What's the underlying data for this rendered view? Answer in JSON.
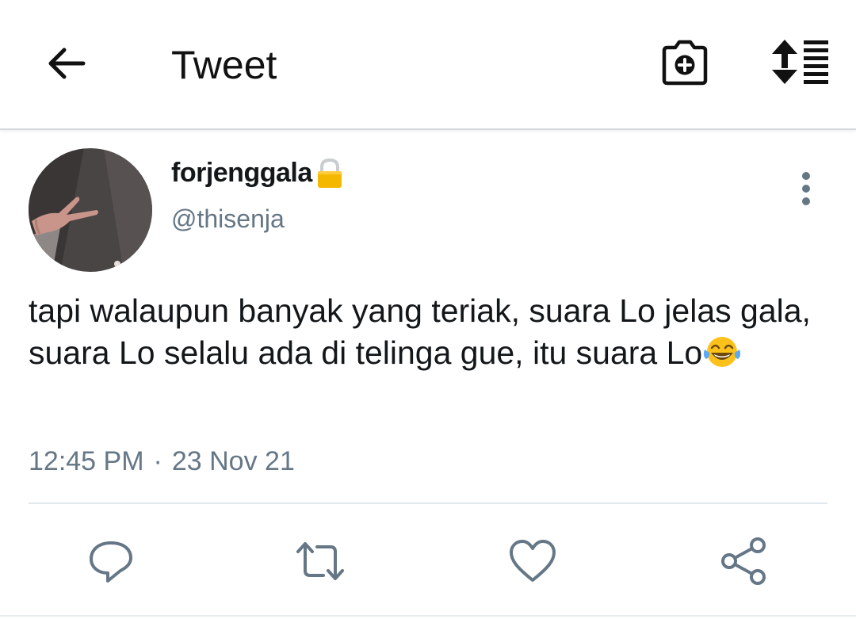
{
  "header": {
    "title": "Tweet",
    "back_icon": "arrow-left-icon",
    "camera_icon": "camera-plus-icon",
    "sort_icon": "sort-list-icon"
  },
  "author": {
    "display_name": "forjenggala",
    "handle": "@thisenja",
    "protected_icon": "lock-icon",
    "avatar_icon": "profile-photo",
    "more_icon": "vertical-dots-icon"
  },
  "tweet": {
    "text": "tapi walaupun banyak yang teriak, suara Lo jelas gala, suara Lo selalu ada di telinga gue, itu suara Lo",
    "emoji": "face-with-tears-of-joy-icon",
    "time": "12:45 PM",
    "separator": "·",
    "date": "23 Nov 21"
  },
  "actions": {
    "reply_icon": "reply-bubble-icon",
    "retweet_icon": "retweet-icon",
    "like_icon": "heart-icon",
    "share_icon": "share-icon"
  },
  "colors": {
    "text": "#14171a",
    "secondary": "#657786",
    "icon": "#657786",
    "divider": "#e1e8ed",
    "lock": "#f5b800"
  }
}
